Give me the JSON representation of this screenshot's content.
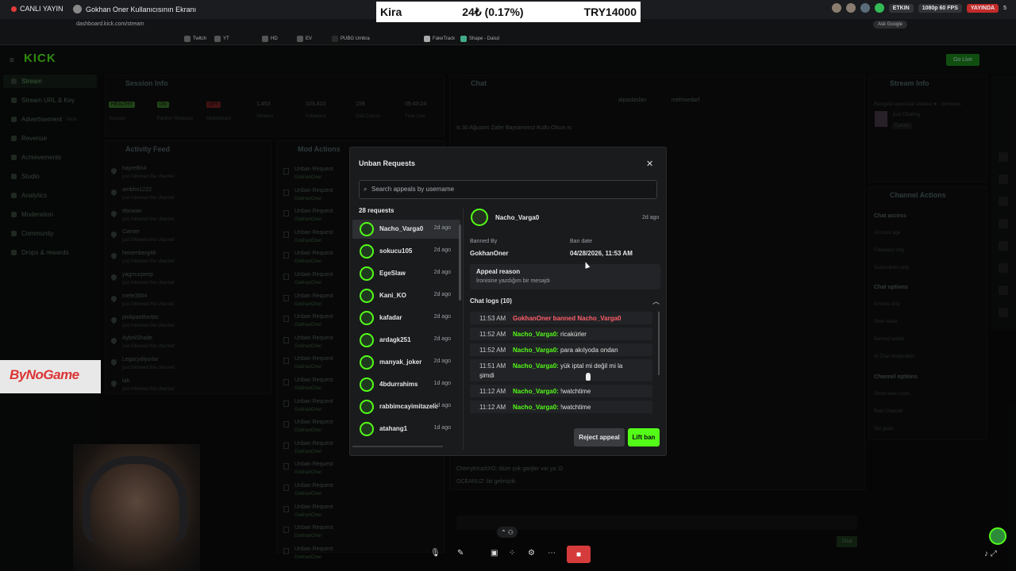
{
  "share_bar": {
    "live_label": "CANLI YAYIN",
    "share_title": "Gokhan Oner Kullanıcısının Ekranı",
    "ticker": {
      "name": "Kira",
      "change": "24₺ (0.17%)",
      "price": "TRY14000"
    },
    "right": {
      "etkin": "ETKIN",
      "quality": "1080p 60 FPS",
      "yayinda": "YAYINDA",
      "viewers": "5"
    }
  },
  "browser": {
    "url": "dashboard.kick.com/stream",
    "google_chip": "Ask Google",
    "bookmarks": [
      "Twitch",
      "YT",
      "HD",
      "EV",
      "PUBG Umbra",
      "FakeTrack",
      "Shape - Daisd"
    ]
  },
  "kick": {
    "logo": "KICK",
    "go_live": "Go Live",
    "sidebar": [
      {
        "label": "Stream",
        "active": true
      },
      {
        "label": "Stream URL & Key"
      },
      {
        "label": "Advertisement",
        "badge": "Beta"
      },
      {
        "label": "Revenue"
      },
      {
        "label": "Achievements"
      },
      {
        "label": "Studio"
      },
      {
        "label": "Analytics"
      },
      {
        "label": "Moderation"
      },
      {
        "label": "Community"
      },
      {
        "label": "Drops & rewards"
      }
    ],
    "session_info": {
      "title": "Session Info",
      "badges": [
        "HEALTHY",
        "ON",
        "OFF"
      ],
      "stats": [
        {
          "value": "1,453",
          "label": "Viewers"
        },
        {
          "value": "103,410",
          "label": "Followers"
        },
        {
          "value": "159",
          "label": "Sub Counts"
        },
        {
          "value": "05:43:24",
          "label": "Time Live"
        }
      ],
      "stat_labels": [
        "Session",
        "Partner Revenue",
        "Multistream"
      ]
    },
    "activity_feed": {
      "title": "Activity Feed",
      "items": [
        "hayretlin4",
        "ambhn1222",
        "ebuwan",
        "Cwnter",
        "heisenberg48",
        "yagmurpeep",
        "mete3564",
        "pinkpantherbtc",
        "AybrkShade",
        "Legacydiyorlar",
        "iah"
      ],
      "sub": "just followed the channel"
    },
    "mod_actions": {
      "title": "Mod Actions",
      "item": "Unban Request",
      "by": "GokhanOner"
    },
    "chat": {
      "title": "Chat",
      "pinned_users": [
        "alpaslaslan",
        "mehmedarf"
      ],
      "pinned_text": "is 30 Ağustos Zafer Bayramımız Kutlu Olsun ıs",
      "bottom_lines": [
        "CherryKrushXO: ölüm çok ganjler var ya :D",
        "OCEANUZ: bit gelmiştik"
      ],
      "send": "Chat"
    },
    "stream_info": {
      "title": "Stream Info",
      "stream_title": "Rastgele oyuncular slitalesi ★ - tumvideo",
      "category": "Just Chatting",
      "tag": "Turkish"
    },
    "channel_actions": {
      "title": "Channel Actions",
      "sections": [
        "Chat access",
        "Chat options",
        "Channel options"
      ],
      "items": [
        "Account age",
        "Followers only",
        "Subscribers only",
        "Emotes only",
        "Slow mode",
        "Banned words",
        "AI Chat Moderation",
        "Show view count",
        "Raid Channel",
        "Set goals"
      ]
    }
  },
  "overlay_logo": "ByNoGame",
  "modal": {
    "title": "Unban Requests",
    "search_placeholder": "Search appeals by username",
    "request_count": "28 requests",
    "requests": [
      {
        "name": "Nacho_Varga0",
        "time": "2d ago",
        "selected": true
      },
      {
        "name": "sokucu105",
        "time": "2d ago"
      },
      {
        "name": "EgeSlaw",
        "time": "2d ago"
      },
      {
        "name": "Kani_KO",
        "time": "2d ago"
      },
      {
        "name": "kafadar",
        "time": "2d ago"
      },
      {
        "name": "ardagk251",
        "time": "2d ago"
      },
      {
        "name": "manyak_joker",
        "time": "2d ago"
      },
      {
        "name": "4bdurrahims",
        "time": "1d ago"
      },
      {
        "name": "rabbimcayimitazele",
        "time": "1d ago"
      },
      {
        "name": "atahang1",
        "time": "1d ago"
      }
    ],
    "detail": {
      "user": "Nacho_Varga0",
      "time": "2d ago",
      "banned_by_label": "Banned By",
      "banned_by": "GokhanOner",
      "ban_date_label": "Ban date",
      "ban_date": "04/28/2026, 11:53 AM",
      "appeal_label": "Appeal reason",
      "appeal_text": "İronisine yazdığım bir mesajdı",
      "logs_title": "Chat logs (10)",
      "logs": [
        {
          "time": "11:53 AM",
          "text": "GokhanOner banned Nacho_Varga0",
          "type": "ban"
        },
        {
          "time": "11:52 AM",
          "user": "Nacho_Varga0:",
          "text": "ricakürler"
        },
        {
          "time": "11:52 AM",
          "user": "Nacho_Varga0:",
          "text": "para akılyoda ondan"
        },
        {
          "time": "11:51 AM",
          "user": "Nacho_Varga0:",
          "text": "yük iptal mi değil mi la",
          "text2": "şimdi"
        },
        {
          "time": "11:12 AM",
          "user": "Nacho_Varga0:",
          "text": "!watchtime"
        },
        {
          "time": "11:12 AM",
          "user": "Nacho_Varga0:",
          "text": "!watchtime"
        }
      ]
    },
    "reject_label": "Reject appeal",
    "lift_label": "Lift ban"
  },
  "colors": {
    "kick_green": "#53fc18",
    "ban_red": "#ff5e6a",
    "modal_bg": "#1a1b1d"
  }
}
